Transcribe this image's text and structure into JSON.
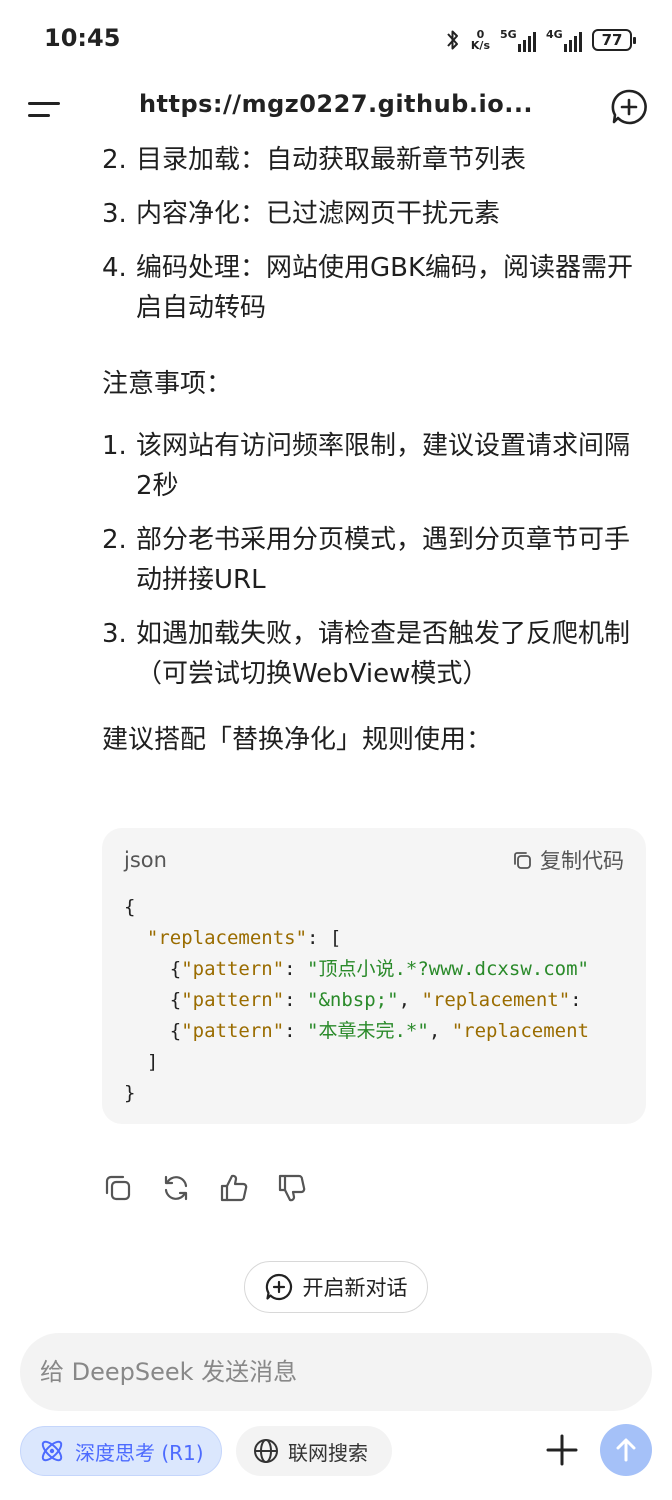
{
  "status_bar": {
    "time": "10:45",
    "net_speed_value": "0",
    "net_speed_unit": "K/s",
    "signal1_label": "5G",
    "signal2_label": "4G",
    "battery": "77",
    "icons": [
      "bluetooth-icon",
      "signal-icon",
      "battery-icon"
    ]
  },
  "header": {
    "title": "https://mgz0227.github.io..."
  },
  "list1": [
    {
      "num": "2.",
      "text": "目录加载：自动获取最新章节列表"
    },
    {
      "num": "3.",
      "text": "内容净化：已过滤网页干扰元素"
    },
    {
      "num": "4.",
      "text": "编码处理：网站使用GBK编码，阅读器需开启自动转码"
    }
  ],
  "notes_title": "注意事项：",
  "list2": [
    {
      "num": "1.",
      "text": "该网站有访问频率限制，建议设置请求间隔2秒"
    },
    {
      "num": "2.",
      "text": "部分老书采用分页模式，遇到分页章节可手动拼接URL"
    },
    {
      "num": "3.",
      "text": "如遇加载失败，请检查是否触发了反爬机制（可尝试切换WebView模式）"
    }
  ],
  "suggestion": "建议搭配「替换净化」规则使用：",
  "code": {
    "lang": "json",
    "copy_label": "复制代码",
    "line1": "{",
    "line2_key": "\"replacements\"",
    "line2_rest": ": [",
    "line3_pre": "    {",
    "line3_key": "\"pattern\"",
    "line3_mid": ": ",
    "line3_val": "\"顶点小说.*?www.dcxsw.com\"",
    "line4_pre": "    {",
    "line4_key": "\"pattern\"",
    "line4_mid": ": ",
    "line4_val": "\"&nbsp;\"",
    "line4_sep": ", ",
    "line4_key2": "\"replacement\"",
    "line4_tail": ":",
    "line5_pre": "    {",
    "line5_key": "\"pattern\"",
    "line5_mid": ": ",
    "line5_val": "\"本章未完.*\"",
    "line5_sep": ", ",
    "line5_key2": "\"replacement",
    "line6": "  ]",
    "line7": "}"
  },
  "actions": [
    "copy-icon",
    "regenerate-icon",
    "thumbs-up-icon",
    "thumbs-down-icon"
  ],
  "new_chat_label": "开启新对话",
  "input": {
    "placeholder": "给 DeepSeek 发送消息"
  },
  "chips": {
    "deep_think": "深度思考 (R1)",
    "web_search": "联网搜索"
  },
  "colors": {
    "accent": "#4d6bfe",
    "send_button": "#a5c1f8",
    "code_key": "#9a6c00",
    "code_string": "#2a8a2a"
  }
}
